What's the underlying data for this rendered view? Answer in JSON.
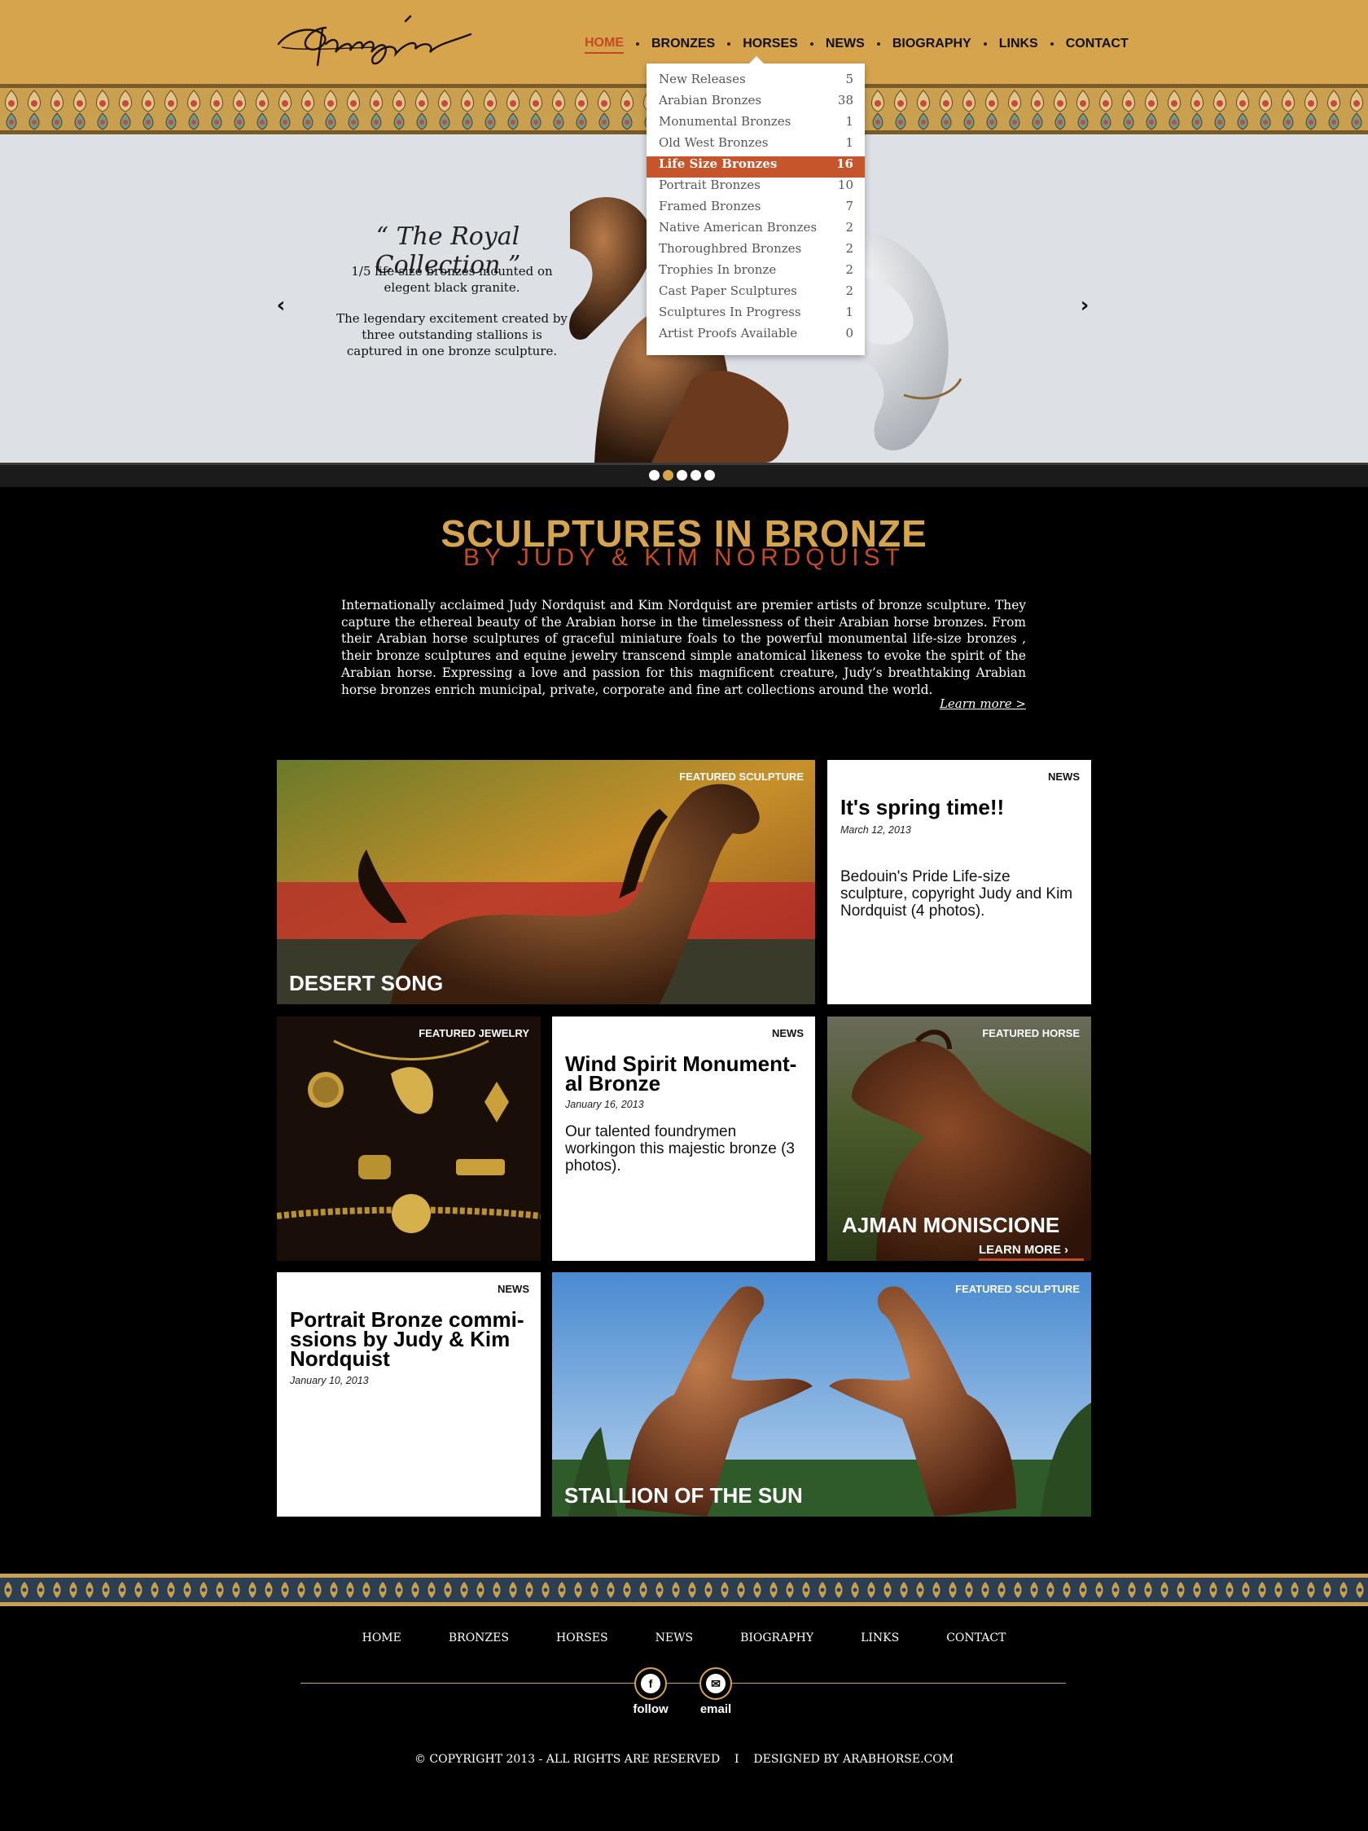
{
  "header": {
    "logo_signature": "Nordquist",
    "nav": [
      "HOME",
      "BRONZES",
      "HORSES",
      "NEWS",
      "BIOGRAPHY",
      "LINKS",
      "CONTACT"
    ],
    "active_nav": "HOME"
  },
  "dropdown": {
    "items": [
      {
        "label": "New Releases",
        "count": "5"
      },
      {
        "label": "Arabian Bronzes",
        "count": "38"
      },
      {
        "label": "Monumental Bronzes",
        "count": "1"
      },
      {
        "label": "Old West Bronzes",
        "count": "1"
      },
      {
        "label": "Life Size Bronzes",
        "count": "16"
      },
      {
        "label": "Portrait Bronzes",
        "count": "10"
      },
      {
        "label": "Framed Bronzes",
        "count": "7"
      },
      {
        "label": "Native American Bronzes",
        "count": "2"
      },
      {
        "label": "Thoroughbred Bronzes",
        "count": "2"
      },
      {
        "label": "Trophies In bronze",
        "count": "2"
      },
      {
        "label": "Cast Paper Sculptures",
        "count": "2"
      },
      {
        "label": "Sculptures In Progress",
        "count": "1"
      },
      {
        "label": "Artist Proofs Available",
        "count": "0"
      }
    ],
    "active_item": "Life Size Bronzes"
  },
  "hero": {
    "title": "“ The Royal Collection ”",
    "copy_1": "1/5 life-size bronzes mounted on elegent black granite.",
    "copy_2": "The legendary excitement created by three outstanding stallions is captured in one bronze sculpture.",
    "prev_arrow": "‹",
    "next_arrow": "›",
    "slide_count": 5,
    "active_slide": 2
  },
  "intro": {
    "title": "SCULPTURES IN BRONZE",
    "subtitle": "BY JUDY & KIM NORDQUIST",
    "body": "Internationally acclaimed Judy Nordquist and Kim Nordquist are premier artists of bronze sculpture. They capture the ethereal beauty of the Arabian horse in the timelessness of their Arabian horse bronzes. From their Arabian horse sculptures of graceful miniature foals to the powerful monumental life-size bronzes , their bronze sculptures and equine jewelry transcend simple anatomical likeness to evoke the spirit of the Arabian horse. Expressing a love and passion for this magnificent creature, Judy’s breathtaking Arabian horse bronzes enrich municipal, private, corporate and fine art collections around the world.",
    "learn_more": "Learn more >"
  },
  "tiles": {
    "desert_song": {
      "tag": "FEATURED SCULPTURE",
      "name": "DESERT SONG"
    },
    "news_spring": {
      "tag": "NEWS",
      "title": "It's spring time!!",
      "date": "March 12, 2013",
      "body": "Bedouin's Pride Life-size sculpture, copyright Judy and Kim Nordquist (4 photos)."
    },
    "jewelry": {
      "tag": "FEATURED JEWELRY"
    },
    "news_wind": {
      "tag": "NEWS",
      "title": "Wind Spirit Monument-al Bronze",
      "date": "January 16, 2013",
      "body": "Our talented foundrymen workingon this majestic bronze (3 photos)."
    },
    "ajman": {
      "tag": "FEATURED HORSE",
      "name": "AJMAN MONISCIONE",
      "learn_more": "LEARN MORE",
      "learn_arrow": "›"
    },
    "news_portrait": {
      "tag": "NEWS",
      "title": "Portrait Bronze commi-ssions by Judy & Kim Nordquist",
      "date": "January 10, 2013"
    },
    "stallion": {
      "tag": "FEATURED SCULPTURE",
      "name": "STALLION OF THE SUN"
    }
  },
  "footer": {
    "nav": [
      "HOME",
      "BRONZES",
      "HORSES",
      "NEWS",
      "BIOGRAPHY",
      "LINKS",
      "CONTACT"
    ],
    "follow_glyph": "f",
    "email_glyph": "✉",
    "follow_label": "follow",
    "email_label": "email",
    "copyright": "© COPYRIGHT 2013 - ALL RIGHTS ARE RESERVED    I    DESIGNED BY ARABHORSE.COM"
  },
  "colors": {
    "gold": "#d7a44e",
    "rust": "#c24a24",
    "dropdown_active": "#c6552b"
  }
}
